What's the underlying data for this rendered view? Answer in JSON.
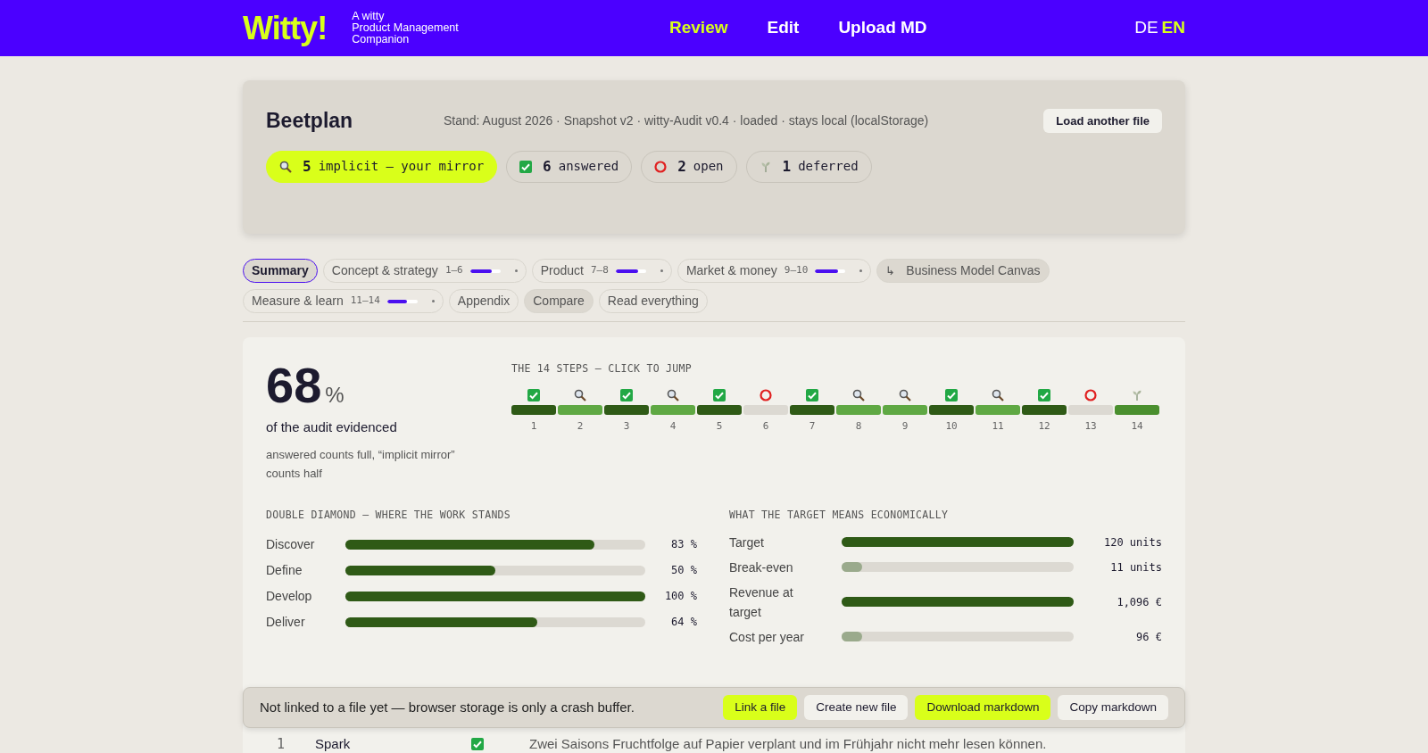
{
  "header": {
    "logo": "Witty!",
    "tagline": [
      "A witty",
      "Product Management",
      "Companion"
    ],
    "nav": [
      {
        "label": "Review",
        "selected": true
      },
      {
        "label": "Edit",
        "selected": false
      },
      {
        "label": "Upload MD",
        "selected": false
      }
    ],
    "languages": [
      {
        "label": "DE",
        "selected": false
      },
      {
        "label": "EN",
        "selected": true
      }
    ]
  },
  "project": {
    "title": "Beetplan",
    "meta": "Stand: August 2026 · Snapshot v2 · witty-Audit v0.4 · loaded · stays local (localStorage)",
    "button": "Load another file",
    "chips": [
      {
        "kind": "implicit",
        "count": "5",
        "label": "implicit — your mirror",
        "selected": true
      },
      {
        "kind": "answered",
        "count": "6",
        "label": "answered",
        "selected": false
      },
      {
        "kind": "open",
        "count": "2",
        "label": "open",
        "selected": false
      },
      {
        "kind": "deferred",
        "count": "1",
        "label": "deferred",
        "selected": false
      }
    ]
  },
  "tabs": [
    {
      "kind": "plain",
      "label": "Summary",
      "selected": true
    },
    {
      "kind": "section",
      "label": "Concept & strategy",
      "range": "1–6",
      "level": 0.7,
      "selected": false
    },
    {
      "kind": "section",
      "label": "Product",
      "range": "7–8",
      "level": 0.75,
      "selected": false
    },
    {
      "kind": "section",
      "label": "Market & money",
      "range": "9–10",
      "level": 0.75,
      "selected": false
    },
    {
      "kind": "tool",
      "arrow": "↳",
      "label": "Business Model Canvas",
      "selected": false
    },
    {
      "kind": "section",
      "label": "Measure & learn",
      "range": "11–14",
      "level": 0.65,
      "selected": false
    },
    {
      "kind": "plain",
      "label": "Appendix",
      "selected": false
    },
    {
      "kind": "tool",
      "label": "Compare",
      "selected": false
    },
    {
      "kind": "plain",
      "label": "Read everything",
      "selected": false
    }
  ],
  "summary": {
    "percent": "68",
    "unit": "%",
    "caption": "of the audit evidenced",
    "note": "answered counts full, “implicit mirror” counts half",
    "steps_title": "THE 14 STEPS — CLICK TO JUMP",
    "steps": [
      {
        "number": "1",
        "kind": "answered"
      },
      {
        "number": "2",
        "kind": "implicit"
      },
      {
        "number": "3",
        "kind": "answered"
      },
      {
        "number": "4",
        "kind": "implicit"
      },
      {
        "number": "5",
        "kind": "answered"
      },
      {
        "number": "6",
        "kind": "open"
      },
      {
        "number": "7",
        "kind": "answered"
      },
      {
        "number": "8",
        "kind": "implicit"
      },
      {
        "number": "9",
        "kind": "implicit"
      },
      {
        "number": "10",
        "kind": "answered"
      },
      {
        "number": "11",
        "kind": "implicit"
      },
      {
        "number": "12",
        "kind": "answered"
      },
      {
        "number": "13",
        "kind": "open"
      },
      {
        "number": "14",
        "kind": "deferred"
      }
    ],
    "diamond": {
      "title": "DOUBLE DIAMOND — WHERE THE WORK STANDS",
      "rows": [
        {
          "label": "Discover",
          "level": 0.83,
          "value": "83 %"
        },
        {
          "label": "Define",
          "level": 0.5,
          "value": "50 %"
        },
        {
          "label": "Develop",
          "level": 1,
          "value": "100 %"
        },
        {
          "label": "Deliver",
          "level": 0.64,
          "value": "64 %"
        }
      ]
    },
    "economics": {
      "title": "WHAT THE TARGET MEANS ECONOMICALLY",
      "rows": [
        {
          "label": "Target",
          "kind": "goal",
          "level": 1,
          "value": "120 units"
        },
        {
          "label": "Break-even",
          "kind": "limit",
          "level": 0.09,
          "value": "11 units"
        },
        {
          "label": "Revenue at target",
          "kind": "goal",
          "level": 1,
          "value": "1,096 €"
        },
        {
          "label": "Cost per year",
          "kind": "limit",
          "level": 0.09,
          "value": "96 €"
        }
      ]
    }
  },
  "table_row": {
    "number": "1",
    "name": "Spark",
    "kind": "answered",
    "text": "Zwei Saisons Fruchtfolge auf Papier verplant und im Frühjahr nicht mehr lesen können."
  },
  "file_bar": {
    "message": "Not linked to a file yet — browser storage is only a crash buffer.",
    "buttons": [
      {
        "label": "Link a file",
        "kind": "primary"
      },
      {
        "label": "Create new file",
        "kind": "secondary"
      },
      {
        "label": "Download markdown",
        "kind": "primary"
      },
      {
        "label": "Copy markdown",
        "kind": "secondary"
      }
    ]
  }
}
